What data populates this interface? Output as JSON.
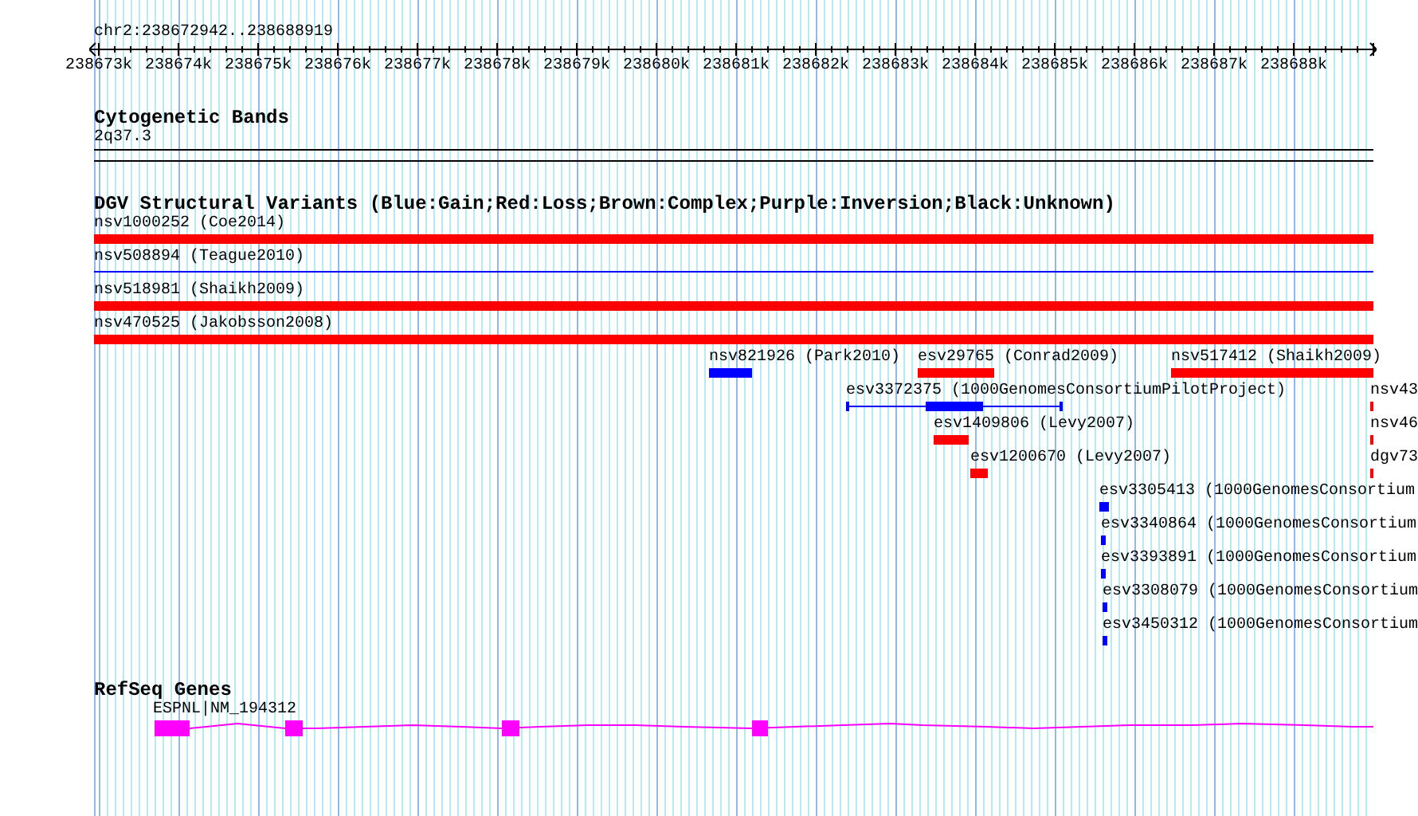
{
  "ruler": {
    "location": "chr2:238672942..238688919",
    "ticks": [
      "238673k",
      "238674k",
      "238675k",
      "238676k",
      "238677k",
      "238678k",
      "238679k",
      "238680k",
      "238681k",
      "238682k",
      "238683k",
      "238684k",
      "238685k",
      "238686k",
      "238687k",
      "238688k"
    ]
  },
  "tracks": [
    {
      "kind": "cytoband",
      "title": "Cytogenetic Bands",
      "band": "2q37.3"
    },
    {
      "kind": "variants",
      "title": "DGV Structural Variants (Blue:Gain;Red:Loss;Brown:Complex;Purple:Inversion;Black:Unknown)",
      "rows": [
        {
          "features": [
            {
              "label": "nsv1000252 (Coe2014)",
              "kind": "block",
              "color": "#ff0000"
            }
          ]
        },
        {
          "features": [
            {
              "label": "nsv508894 (Teague2010)",
              "kind": "line",
              "color": "#0000ff"
            }
          ]
        },
        {
          "features": [
            {
              "label": "nsv518981 (Shaikh2009)",
              "kind": "block",
              "color": "#ff0000"
            }
          ]
        },
        {
          "features": [
            {
              "label": "nsv470525 (Jakobsson2008)",
              "kind": "block",
              "color": "#ff0000"
            }
          ]
        },
        {
          "features": [
            {
              "label": "nsv821926 (Park2010)",
              "kind": "block",
              "color": "#0000ff"
            },
            {
              "label": "esv29765 (Conrad2009)",
              "kind": "block",
              "color": "#ff0000"
            },
            {
              "label": "nsv517412 (Shaikh2009)",
              "kind": "block",
              "color": "#ff0000"
            }
          ]
        },
        {
          "features": [
            {
              "label": "esv3372375 (1000GenomesConsortiumPilotProject)",
              "kind": "gapped",
              "color": "#0000ff"
            },
            {
              "label": "nsv43",
              "kind": "block",
              "color": "#ff0000"
            }
          ]
        },
        {
          "features": [
            {
              "label": "esv1409806 (Levy2007)",
              "kind": "block",
              "color": "#ff0000"
            },
            {
              "label": "nsv46",
              "kind": "block",
              "color": "#ff0000"
            }
          ]
        },
        {
          "features": [
            {
              "label": "esv1200670 (Levy2007)",
              "kind": "block",
              "color": "#ff0000"
            },
            {
              "label": "dgv73",
              "kind": "block",
              "color": "#ff0000"
            }
          ]
        },
        {
          "features": [
            {
              "label": "esv3305413 (1000GenomesConsortium",
              "kind": "block",
              "color": "#0000ff"
            }
          ]
        },
        {
          "features": [
            {
              "label": "esv3340864 (1000GenomesConsortium",
              "kind": "block",
              "color": "#0000ff"
            }
          ]
        },
        {
          "features": [
            {
              "label": "esv3393891 (1000GenomesConsortium",
              "kind": "block",
              "color": "#0000ff"
            }
          ]
        },
        {
          "features": [
            {
              "label": "esv3308079 (1000GenomesConsortium",
              "kind": "block",
              "color": "#0000ff"
            }
          ]
        },
        {
          "features": [
            {
              "label": "esv3450312 (1000GenomesConsortium",
              "kind": "block",
              "color": "#0000ff"
            }
          ]
        }
      ]
    },
    {
      "kind": "genes",
      "title": "RefSeq Genes",
      "genes": [
        {
          "label": "ESPNL|NM_194312"
        }
      ]
    }
  ]
}
